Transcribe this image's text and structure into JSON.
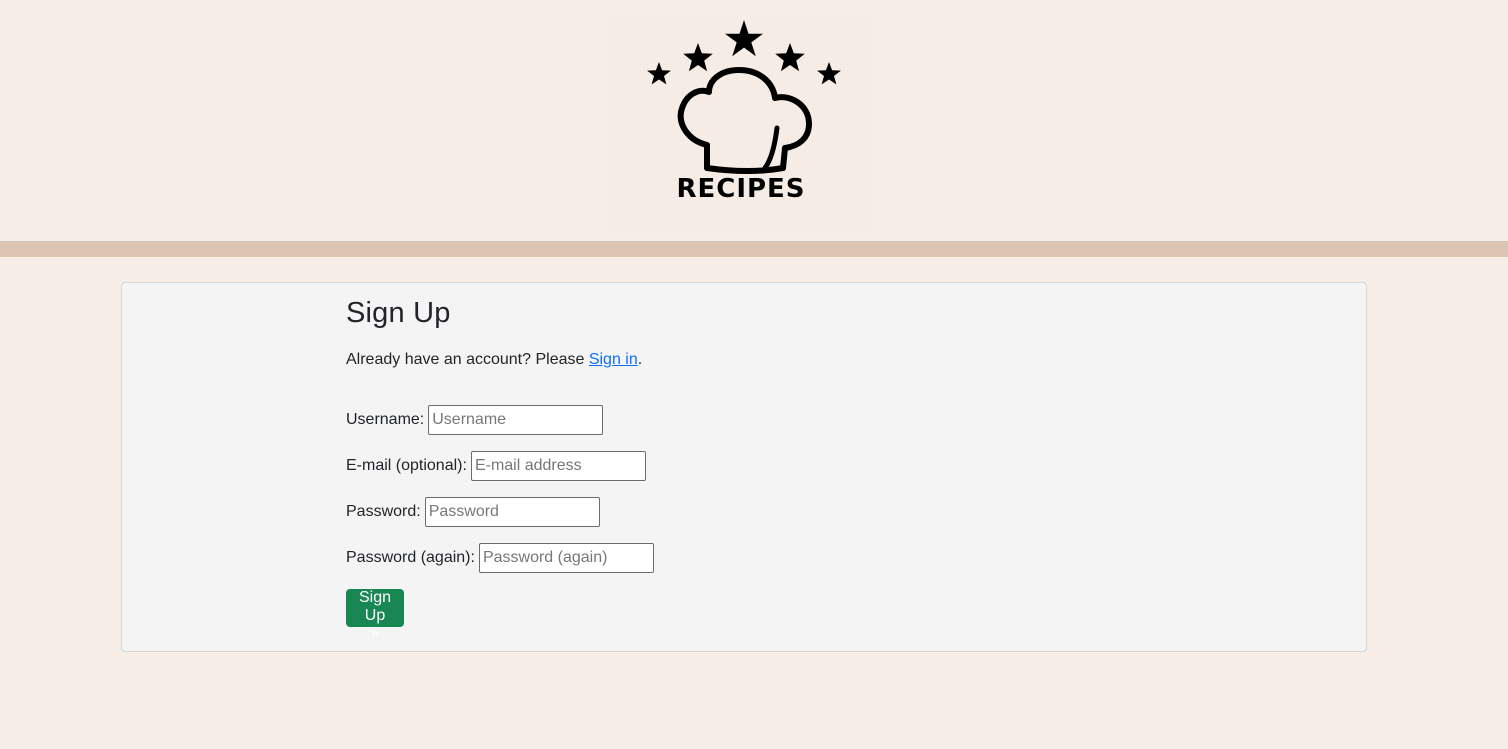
{
  "header": {
    "logo_text": "RECIPES",
    "logo_icon": "chef-hat-with-five-stars"
  },
  "form": {
    "title": "Sign Up",
    "intro_prefix": "Already have an account? Please ",
    "signin_link": "Sign in",
    "intro_suffix": ".",
    "fields": {
      "username": {
        "label": "Username:",
        "placeholder": "Username",
        "value": ""
      },
      "email": {
        "label": "E-mail (optional):",
        "placeholder": "E-mail address",
        "value": ""
      },
      "password": {
        "label": "Password:",
        "placeholder": "Password",
        "value": ""
      },
      "password2": {
        "label": "Password (again):",
        "placeholder": "Password (again)",
        "value": ""
      }
    },
    "submit_label": "Sign Up »"
  },
  "colors": {
    "page_bg": "#f6eee6",
    "divider": "#dcc5b3",
    "card_bg": "#f4f4f4",
    "link": "#0d6efd",
    "button": "#198754"
  }
}
